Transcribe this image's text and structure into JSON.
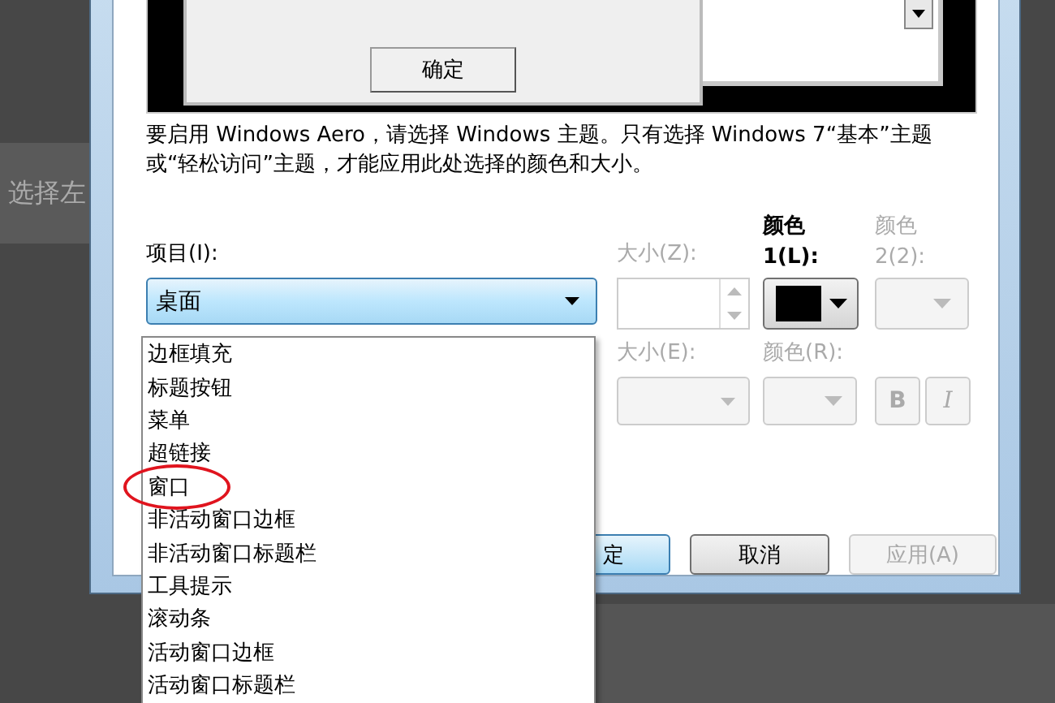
{
  "background": {
    "text": "选择左"
  },
  "dialog": {
    "preview": {
      "button": "确定"
    },
    "description": "要启用 Windows Aero，请选择 Windows 主题。只有选择 Windows 7“基本”主题或“轻松访问”主题，才能应用此处选择的颜色和大小。",
    "item_label": "项目(I):",
    "item_value": "桌面",
    "size_label": {
      "text": "大小(Z):",
      "disabled": true
    },
    "color1_label": {
      "lines": [
        "颜色",
        "1(L):"
      ],
      "disabled": false
    },
    "color2_label": {
      "lines": [
        "颜色",
        "2(2):"
      ],
      "disabled": true
    },
    "color1_swatch": {
      "color": "#000000"
    },
    "font_size_label": {
      "text": "大小(E):",
      "disabled": true
    },
    "font_color_label": {
      "text": "颜色(R):",
      "disabled": true
    },
    "bold_button": {
      "text": "B",
      "disabled": true
    },
    "italic_button": {
      "text": "I",
      "disabled": true
    },
    "buttons": [
      {
        "label": "定",
        "kind": "default",
        "disabled": false
      },
      {
        "label": "取消",
        "kind": "normal",
        "disabled": false
      },
      {
        "label": "应用(A)",
        "kind": "normal",
        "disabled": true
      }
    ]
  },
  "dropdown": {
    "items": [
      {
        "label": "边框填充",
        "circled": false
      },
      {
        "label": "标题按钮",
        "circled": false
      },
      {
        "label": "菜单",
        "circled": false
      },
      {
        "label": "超链接",
        "circled": false
      },
      {
        "label": "窗口",
        "circled": true
      },
      {
        "label": "非活动窗口边框",
        "circled": false
      },
      {
        "label": "非活动窗口标题栏",
        "circled": false
      },
      {
        "label": "工具提示",
        "circled": false
      },
      {
        "label": "滚动条",
        "circled": false
      },
      {
        "label": "活动窗口边框",
        "circled": false
      },
      {
        "label": "活动窗口标题栏",
        "circled": false
      }
    ]
  }
}
